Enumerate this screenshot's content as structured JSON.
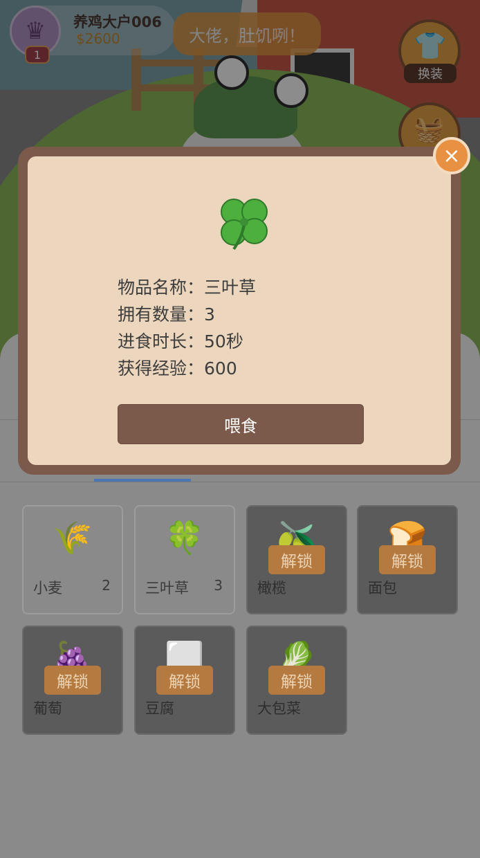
{
  "header": {
    "user_name": "养鸡大户006",
    "coins": "$2600",
    "level": "1",
    "speech": "大佬，肚饥咧！",
    "dress_label": "换装"
  },
  "modal": {
    "item_icon": "clover-icon",
    "rows": [
      {
        "label": "物品名称：",
        "value": "三叶草"
      },
      {
        "label": "拥有数量：",
        "value": "3"
      },
      {
        "label": "进食时长：",
        "value": "50秒"
      },
      {
        "label": "获得经验：",
        "value": "600"
      }
    ],
    "feed_label": "喂食",
    "close_symbol": "×"
  },
  "items": [
    {
      "name": "小麦",
      "count": "2",
      "locked": false,
      "icon": "wheat-icon"
    },
    {
      "name": "三叶草",
      "count": "3",
      "locked": false,
      "icon": "clover-icon"
    },
    {
      "name": "橄榄",
      "count": "",
      "locked": true,
      "icon": "olive-icon"
    },
    {
      "name": "面包",
      "count": "",
      "locked": true,
      "icon": "bread-icon"
    },
    {
      "name": "葡萄",
      "count": "",
      "locked": true,
      "icon": "grape-icon"
    },
    {
      "name": "豆腐",
      "count": "",
      "locked": true,
      "icon": "tofu-icon"
    },
    {
      "name": "大包菜",
      "count": "",
      "locked": true,
      "icon": "cabbage-icon"
    }
  ],
  "unlock_label": "解锁"
}
